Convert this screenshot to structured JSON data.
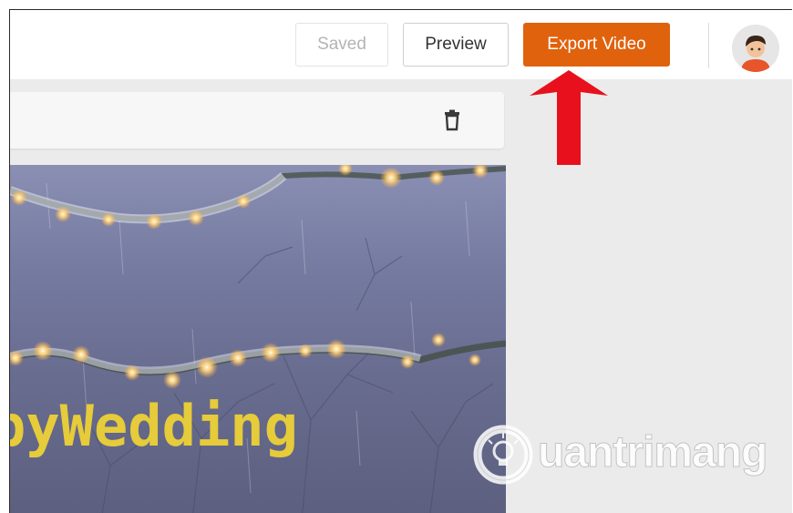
{
  "header": {
    "saved_label": "Saved",
    "preview_label": "Preview",
    "export_label": "Export Video",
    "avatar_icon": "user-avatar-icon"
  },
  "toolbar": {
    "delete_icon": "trash-icon"
  },
  "canvas": {
    "text": "pyWedding"
  },
  "watermark": {
    "text": "uantrimang"
  },
  "colors": {
    "export_button": "#e0620d",
    "arrow": "#e8101c",
    "canvas_text": "#e6cb3a"
  }
}
